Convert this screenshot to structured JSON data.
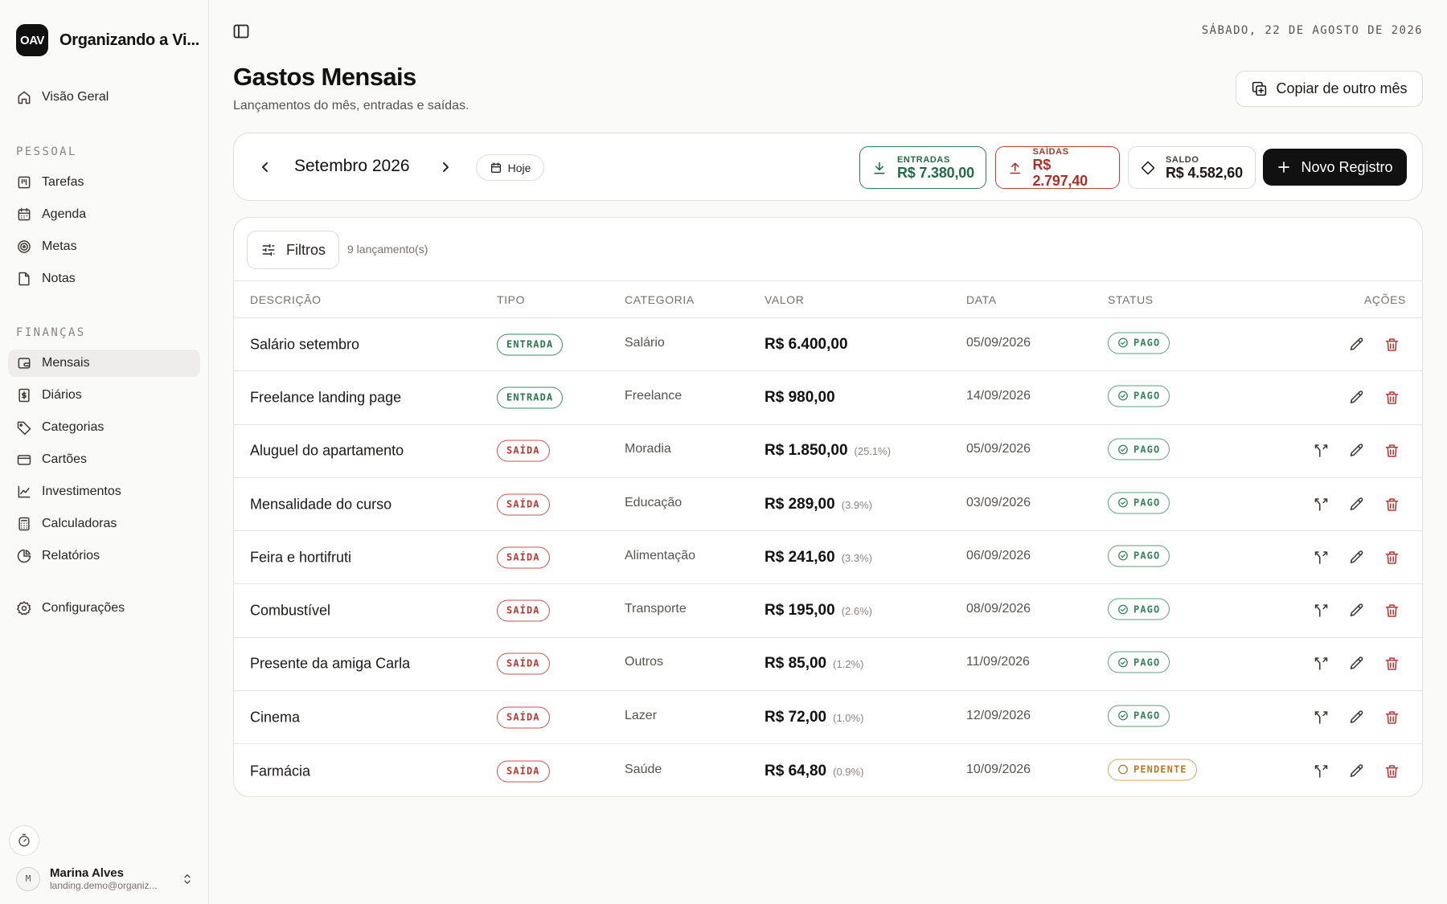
{
  "app": {
    "logo": "OAV",
    "name": "Organizando a Vi..."
  },
  "sidebar": {
    "overview": "Visão Geral",
    "section_personal": "PESSOAL",
    "personal": [
      "Tarefas",
      "Agenda",
      "Metas",
      "Notas"
    ],
    "section_finance": "FINANÇAS",
    "finance": [
      "Mensais",
      "Diários",
      "Categorias",
      "Cartões",
      "Investimentos",
      "Calculadoras",
      "Relatórios"
    ],
    "settings": "Configurações",
    "active_item": "Mensais"
  },
  "user": {
    "initial": "M",
    "name": "Marina Alves",
    "email": "landing.demo@organiz..."
  },
  "header": {
    "date": "SÁBADO, 22 DE AGOSTO DE 2026",
    "title": "Gastos Mensais",
    "subtitle": "Lançamentos do mês, entradas e saídas.",
    "copy_button": "Copiar de outro mês"
  },
  "month_bar": {
    "month": "Setembro 2026",
    "today": "Hoje",
    "income_label": "ENTRADAS",
    "income_value": "R$ 7.380,00",
    "expense_label": "SAÍDAS",
    "expense_value": "R$ 2.797,40",
    "balance_label": "SALDO",
    "balance_value": "R$ 4.582,60",
    "new_button": "Novo Registro"
  },
  "table": {
    "filters": "Filtros",
    "count": "9 lançamento(s)",
    "headers": [
      "DESCRIÇÃO",
      "TIPO",
      "CATEGORIA",
      "VALOR",
      "DATA",
      "STATUS",
      "AÇÕES"
    ],
    "rows": [
      {
        "desc": "Salário setembro",
        "tipo": "ENTRADA",
        "cat": "Salário",
        "valor": "R$ 6.400,00",
        "pct": "",
        "data": "05/09/2026",
        "status": "PAGO"
      },
      {
        "desc": "Freelance landing page",
        "tipo": "ENTRADA",
        "cat": "Freelance",
        "valor": "R$ 980,00",
        "pct": "",
        "data": "14/09/2026",
        "status": "PAGO"
      },
      {
        "desc": "Aluguel do apartamento",
        "tipo": "SAÍDA",
        "cat": "Moradia",
        "valor": "R$ 1.850,00",
        "pct": "(25.1%)",
        "data": "05/09/2026",
        "status": "PAGO"
      },
      {
        "desc": "Mensalidade do curso",
        "tipo": "SAÍDA",
        "cat": "Educação",
        "valor": "R$ 289,00",
        "pct": "(3.9%)",
        "data": "03/09/2026",
        "status": "PAGO"
      },
      {
        "desc": "Feira e hortifruti",
        "tipo": "SAÍDA",
        "cat": "Alimentação",
        "valor": "R$ 241,60",
        "pct": "(3.3%)",
        "data": "06/09/2026",
        "status": "PAGO"
      },
      {
        "desc": "Combustível",
        "tipo": "SAÍDA",
        "cat": "Transporte",
        "valor": "R$ 195,00",
        "pct": "(2.6%)",
        "data": "08/09/2026",
        "status": "PAGO"
      },
      {
        "desc": "Presente da amiga Carla",
        "tipo": "SAÍDA",
        "cat": "Outros",
        "valor": "R$ 85,00",
        "pct": "(1.2%)",
        "data": "11/09/2026",
        "status": "PAGO"
      },
      {
        "desc": "Cinema",
        "tipo": "SAÍDA",
        "cat": "Lazer",
        "valor": "R$ 72,00",
        "pct": "(1.0%)",
        "data": "12/09/2026",
        "status": "PAGO"
      },
      {
        "desc": "Farmácia",
        "tipo": "SAÍDA",
        "cat": "Saúde",
        "valor": "R$ 64,80",
        "pct": "(0.9%)",
        "data": "10/09/2026",
        "status": "PENDENTE"
      }
    ]
  },
  "icons": {
    "nav": [
      "home-icon",
      "kanban-icon",
      "calendar-icon",
      "target-icon",
      "note-icon",
      "wallet-icon",
      "receipt-icon",
      "tag-icon",
      "credit-card-icon",
      "line-chart-icon",
      "calculator-icon",
      "pie-chart-icon",
      "gear-icon"
    ],
    "row_actions": [
      "split-icon",
      "pencil-icon",
      "trash-icon"
    ]
  },
  "colors": {
    "income": "#236b46",
    "expense": "#a8322b",
    "pending": "#b4792a",
    "primary": "#111111"
  }
}
